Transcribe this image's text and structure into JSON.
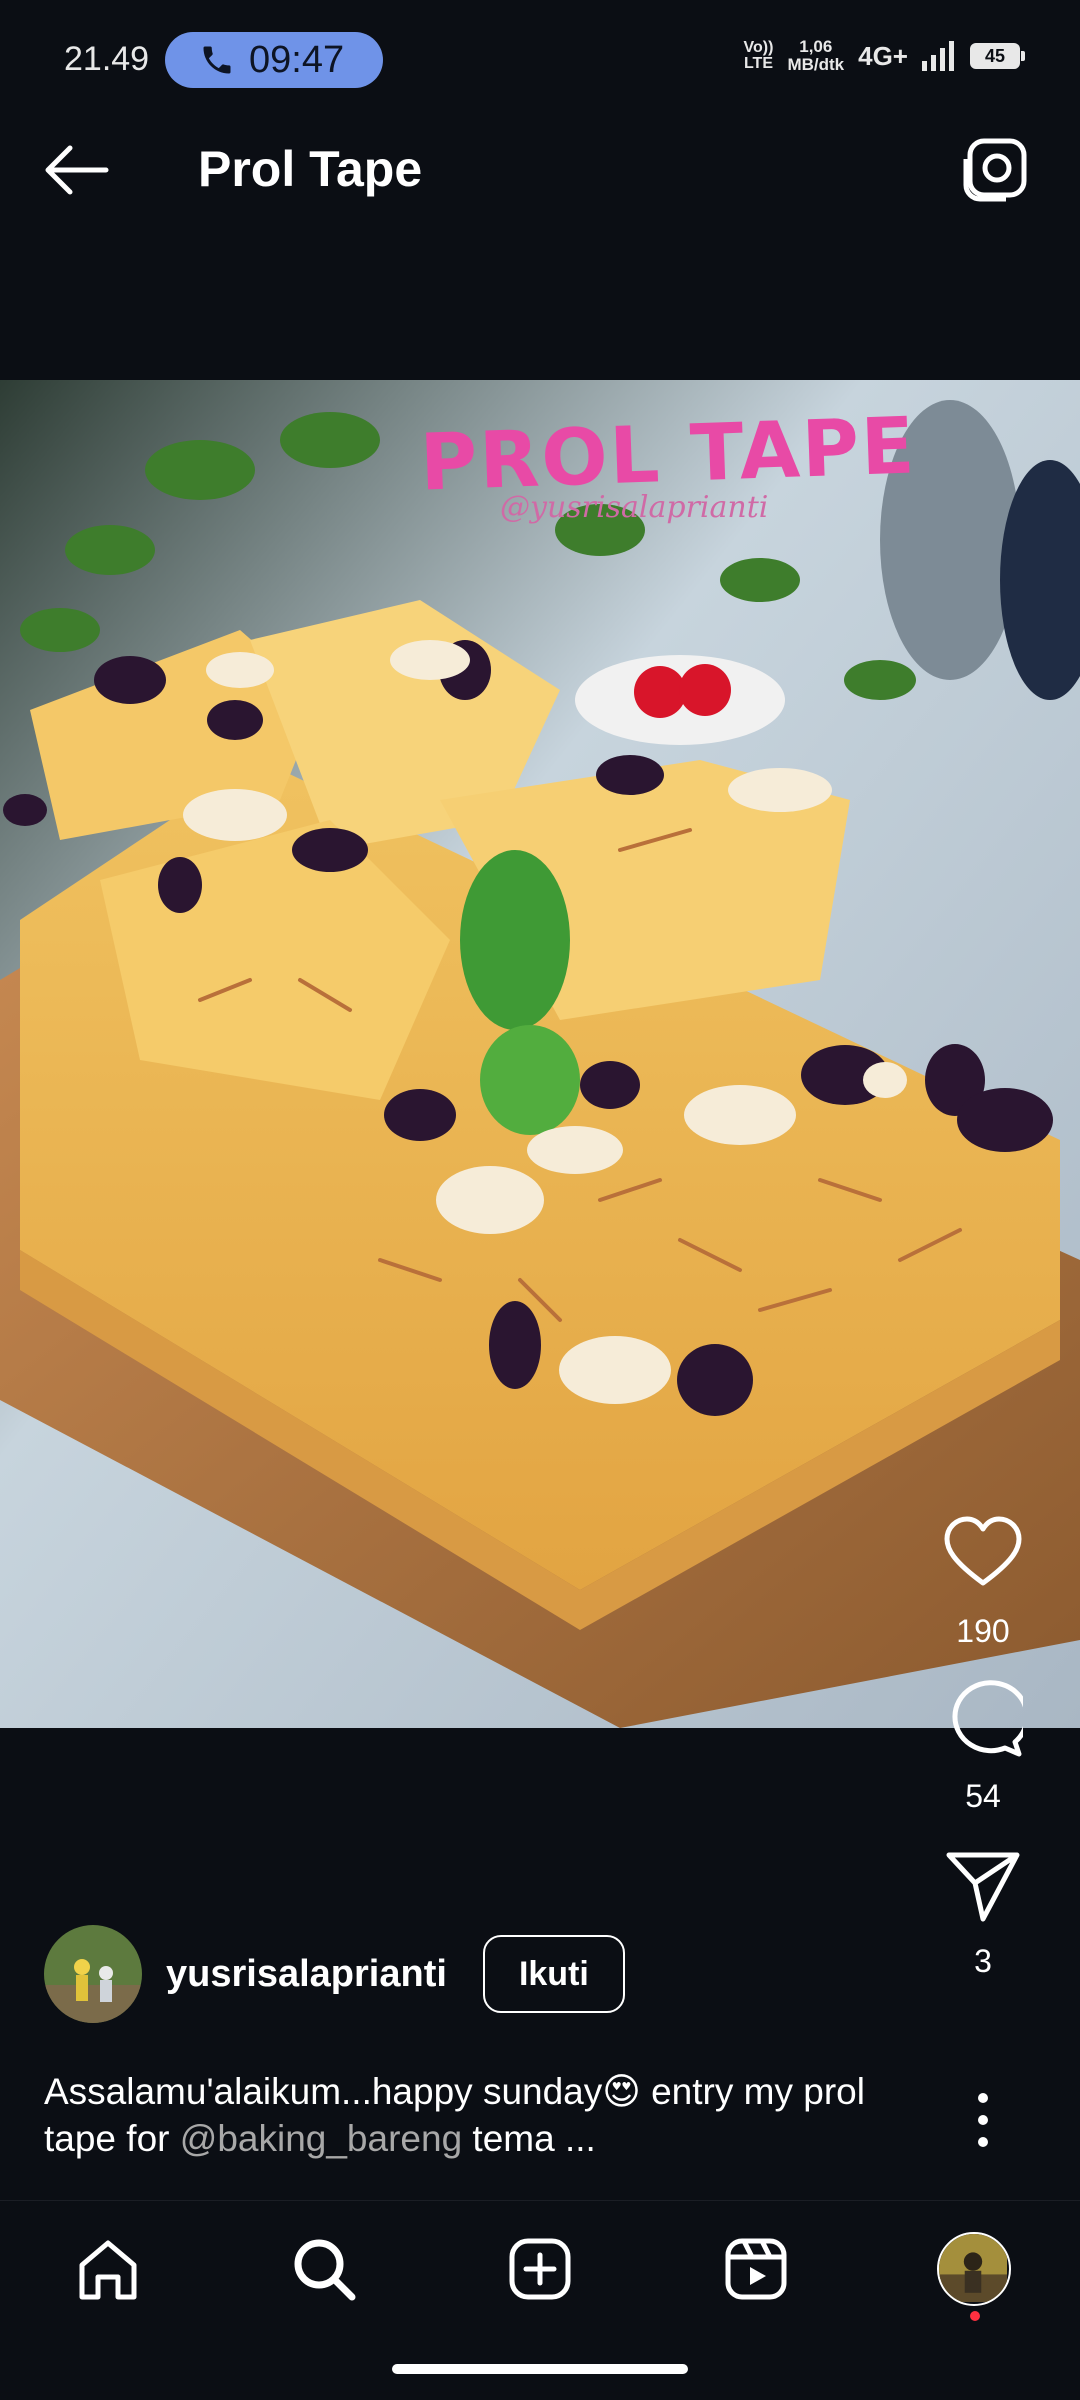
{
  "status_bar": {
    "time": "21.49",
    "call_time": "09:47",
    "volte_top": "Vo))",
    "volte_bottom": "LTE",
    "speed_value": "1,06",
    "speed_unit": "MB/dtk",
    "network": "4G+",
    "battery": "45"
  },
  "header": {
    "title": "Prol Tape"
  },
  "post": {
    "overlay_title": "PROL TAPE",
    "overlay_handle": "@yusrisalaprianti",
    "likes": "190",
    "comments": "54",
    "shares": "3"
  },
  "author": {
    "username": "yusrisalaprianti",
    "follow_label": "Ikuti"
  },
  "caption": {
    "text_before": "Assalamu'alaikum...happy sunday😍 entry my prol tape for ",
    "mention": "@baking_bareng",
    "text_after": " tema ..."
  },
  "icons": {
    "back": "arrow-left-icon",
    "camera": "camera-icon",
    "like": "heart-icon",
    "comment": "comment-icon",
    "share": "paper-plane-icon",
    "more": "more-vertical-icon",
    "home": "home-icon",
    "search": "search-icon",
    "create": "plus-square-icon",
    "reels": "reels-icon",
    "profile": "profile-avatar"
  },
  "colors": {
    "background": "#0b0e14",
    "call_pill": "#6f93e8",
    "overlay_pink": "#e84aa6",
    "notification_dot": "#ff3040"
  }
}
